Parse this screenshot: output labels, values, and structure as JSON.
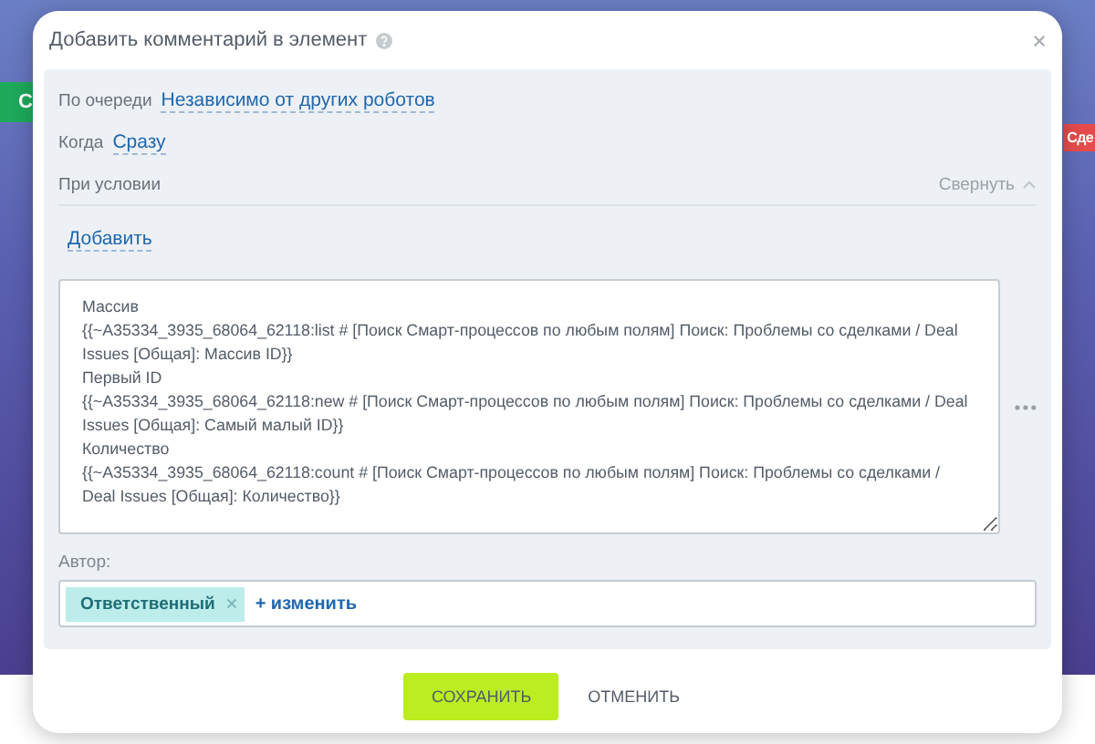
{
  "background": {
    "left_button": "С",
    "right_tag": "Сде"
  },
  "dialog": {
    "title": "Добавить комментарий в элемент",
    "queue": {
      "label": "По очереди",
      "value": "Независимо от других роботов"
    },
    "when": {
      "label": "Когда",
      "value": "Сразу"
    },
    "condition": {
      "label": "При условии",
      "collapse": "Свернуть",
      "expanded": true,
      "add": "Добавить"
    },
    "comment": {
      "value": "Массив\n{{~A35334_3935_68064_62118:list # [Поиск Смарт-процессов по любым полям] Поиск: Проблемы со сделками / Deal Issues [Общая]: Массив ID}}\nПервый ID\n{{~A35334_3935_68064_62118:new # [Поиск Смарт-процессов по любым полям] Поиск: Проблемы со сделками / Deal Issues [Общая]: Самый малый ID}}\nКоличество\n{{~A35334_3935_68064_62118:count # [Поиск Смарт-процессов по любым полям] Поиск: Проблемы со сделками / Deal Issues [Общая]: Количество}}"
    },
    "author": {
      "label": "Автор:",
      "tags": [
        "Ответственный"
      ],
      "change": "+ изменить"
    },
    "buttons": {
      "save": "СОХРАНИТЬ",
      "cancel": "ОТМЕНИТЬ"
    }
  }
}
